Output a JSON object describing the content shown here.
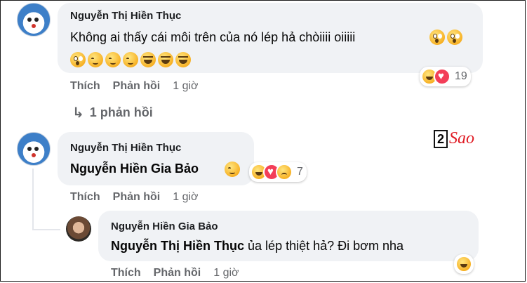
{
  "comments": [
    {
      "author": "Nguyễn Thị Hiền Thục",
      "text": "Không ai thấy cái môi trên của nó lép hả chòiiii oiiiii",
      "reactions_count": "19",
      "actions": {
        "like": "Thích",
        "reply": "Phản hồi",
        "time": "1 giờ"
      },
      "replies_link": "1 phản hồi"
    },
    {
      "author": "Nguyễn Thị Hiền Thục",
      "mention": "Nguyễn Hiền Gia Bảo",
      "reactions_count": "7",
      "actions": {
        "like": "Thích",
        "reply": "Phản hồi",
        "time": "1 giờ"
      }
    }
  ],
  "reply": {
    "author": "Nguyễn Hiền Gia Bảo",
    "mention": "Nguyễn Thị Hiền Thục",
    "text": "ủa lép thiệt hả? Đi bơm nha",
    "actions": {
      "like": "Thích",
      "reply": "Phản hồi",
      "time": "1 giờ"
    }
  },
  "watermark": {
    "box": "2",
    "text": "Sao"
  },
  "colors": {
    "bubble": "#f0f2f5",
    "meta": "#65676b",
    "love": "#f33e58",
    "watermark_red": "#e01b24"
  },
  "icons": [
    "shocked-emoji",
    "blush-emoji",
    "laughing-emoji",
    "haha-reaction",
    "love-reaction",
    "sad-reaction",
    "reply-arrow"
  ]
}
